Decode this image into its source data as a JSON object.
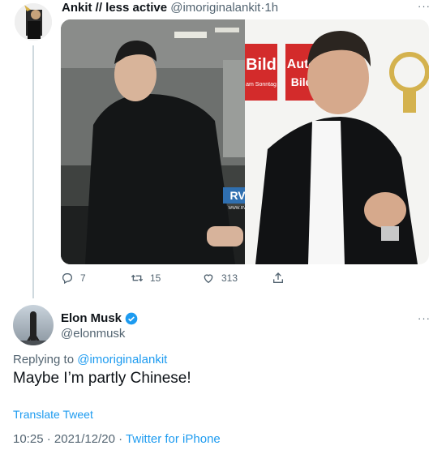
{
  "tweet1": {
    "author_name": "Ankit // less active",
    "handle": "@imoriginalankit",
    "separator": "·",
    "time": "1h",
    "more": "···",
    "media": {
      "watermark": "RVCJ",
      "watermark_sub": "WWW.RVCJ.COM",
      "sign_text_1": "Bild",
      "sign_text_1_sub": "am Sonntag",
      "sign_text_2": "Auto",
      "sign_text_2_sub": "Bild"
    },
    "actions": {
      "reply_icon": "reply-icon",
      "reply_count": "7",
      "retweet_icon": "retweet-icon",
      "retweet_count": "15",
      "like_icon": "heart-icon",
      "like_count": "313",
      "share_icon": "share-icon"
    }
  },
  "tweet2": {
    "author_name": "Elon Musk",
    "handle": "@elonmusk",
    "verified_icon": "verified-badge-icon",
    "more": "···",
    "replying_prefix": "Replying to",
    "replying_handle": "@imoriginalankit",
    "text": "Maybe I’m partly Chinese!",
    "translate": "Translate Tweet",
    "time": "10:25",
    "separator": "·",
    "date": "2021/12/20",
    "separator2": "·",
    "source": "Twitter for iPhone"
  },
  "colors": {
    "accent": "#1d9bf0",
    "muted": "#536471",
    "text": "#0f1419",
    "thread_line": "#cfd9de"
  }
}
